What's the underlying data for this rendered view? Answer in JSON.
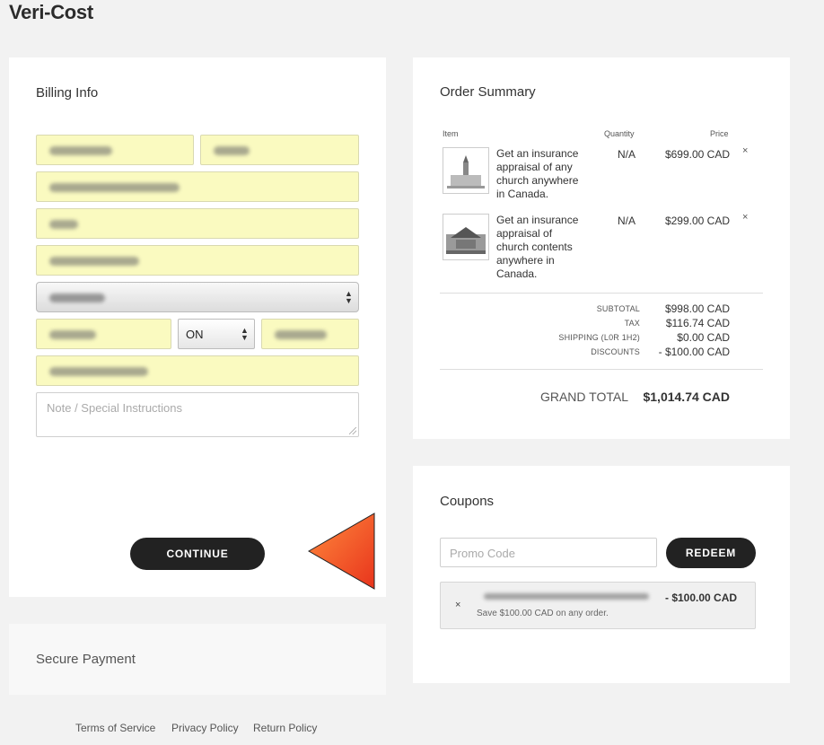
{
  "site": {
    "title": "Veri-Cost"
  },
  "billing": {
    "heading": "Billing Info",
    "province": "ON",
    "note_placeholder": "Note / Special Instructions",
    "continue_label": "CONTINUE"
  },
  "secure": {
    "heading": "Secure Payment"
  },
  "order": {
    "heading": "Order Summary",
    "columns": {
      "item": "Item",
      "quantity": "Quantity",
      "price": "Price"
    },
    "items": [
      {
        "description": "Get an insurance appraisal of any church anywhere in Canada.",
        "quantity": "N/A",
        "price": "$699.00 CAD",
        "remove": "×"
      },
      {
        "description": "Get an insurance appraisal of church contents anywhere in Canada.",
        "quantity": "N/A",
        "price": "$299.00 CAD",
        "remove": "×"
      }
    ],
    "totals": {
      "subtotal_label": "SUBTOTAL",
      "subtotal": "$998.00 CAD",
      "tax_label": "TAX",
      "tax": "$116.74 CAD",
      "shipping_label": "SHIPPING (L0R 1H2)",
      "shipping": "$0.00 CAD",
      "discounts_label": "DISCOUNTS",
      "discounts": "- $100.00 CAD",
      "grand_label": "GRAND TOTAL",
      "grand": "$1,014.74 CAD"
    }
  },
  "coupons": {
    "heading": "Coupons",
    "promo_placeholder": "Promo Code",
    "redeem_label": "REDEEM",
    "applied": {
      "remove": "×",
      "amount": "- $100.00 CAD",
      "description": "Save $100.00 CAD on any order."
    }
  },
  "footer": {
    "links": [
      "Terms of Service",
      "Privacy Policy",
      "Return Policy"
    ]
  },
  "colors": {
    "accent_arrow": "#f4511e",
    "autofill": "#fafac0",
    "button": "#222222"
  }
}
